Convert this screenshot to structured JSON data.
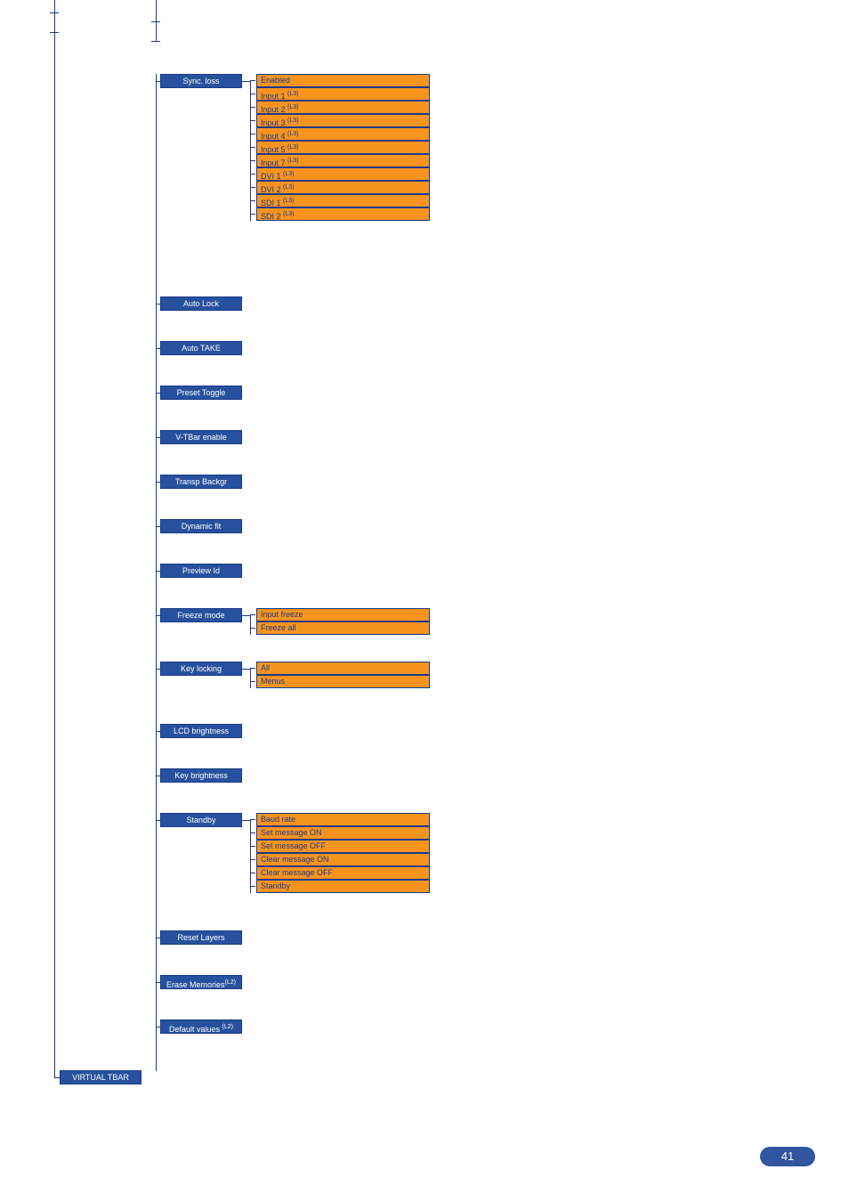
{
  "page_number": "41",
  "col1": {
    "sync_loss": "Sync. loss",
    "auto_lock": "Auto Lock",
    "auto_take": "Auto TAKE",
    "preset_toggle": "Preset Toggle",
    "vtbar_enable": "V-TBar enable",
    "transp_backgr": "Transp Backgr",
    "dynamic_fit": "Dynamic fit",
    "preview_id": "Preview Id",
    "freeze_mode": "Freeze mode",
    "key_locking": "Key locking",
    "lcd_brightness": "LCD brightness",
    "key_brightness": "Key brightness",
    "standby": "Standby",
    "reset_layers": "Reset Layers",
    "erase_memories": "Erase Memories",
    "erase_memories_sup": "(L2)",
    "default_values": "Default values ",
    "default_values_sup": "(L2)"
  },
  "sync_loss_items": [
    {
      "label": "Enabled",
      "sup": ""
    },
    {
      "label": "Input 1 ",
      "sup": "(L3)"
    },
    {
      "label": "Input 2 ",
      "sup": "(L3)"
    },
    {
      "label": "Input 3 ",
      "sup": "(L3)"
    },
    {
      "label": "Input 4 ",
      "sup": "(L3)"
    },
    {
      "label": "Input 5 ",
      "sup": "(L3)"
    },
    {
      "label": "Input 7 ",
      "sup": "(L3)"
    },
    {
      "label": "DVI 1 ",
      "sup": "(L3)"
    },
    {
      "label": "DVI 2 ",
      "sup": "(L3)"
    },
    {
      "label": "SDI 1 ",
      "sup": "(L3)"
    },
    {
      "label": "SDI 2 ",
      "sup": "(L3)"
    }
  ],
  "freeze_items": [
    {
      "label": "Input freeze"
    },
    {
      "label": "Freeze all"
    }
  ],
  "keylock_items": [
    {
      "label": "All"
    },
    {
      "label": "Menus"
    }
  ],
  "standby_items": [
    {
      "label": "Baud rate"
    },
    {
      "label": "Set message ON"
    },
    {
      "label": "Set message OFF"
    },
    {
      "label": "Clear message ON"
    },
    {
      "label": "Clear message OFF"
    },
    {
      "label": "Standby"
    }
  ],
  "virtual_tbar": "VIRTUAL TBAR"
}
